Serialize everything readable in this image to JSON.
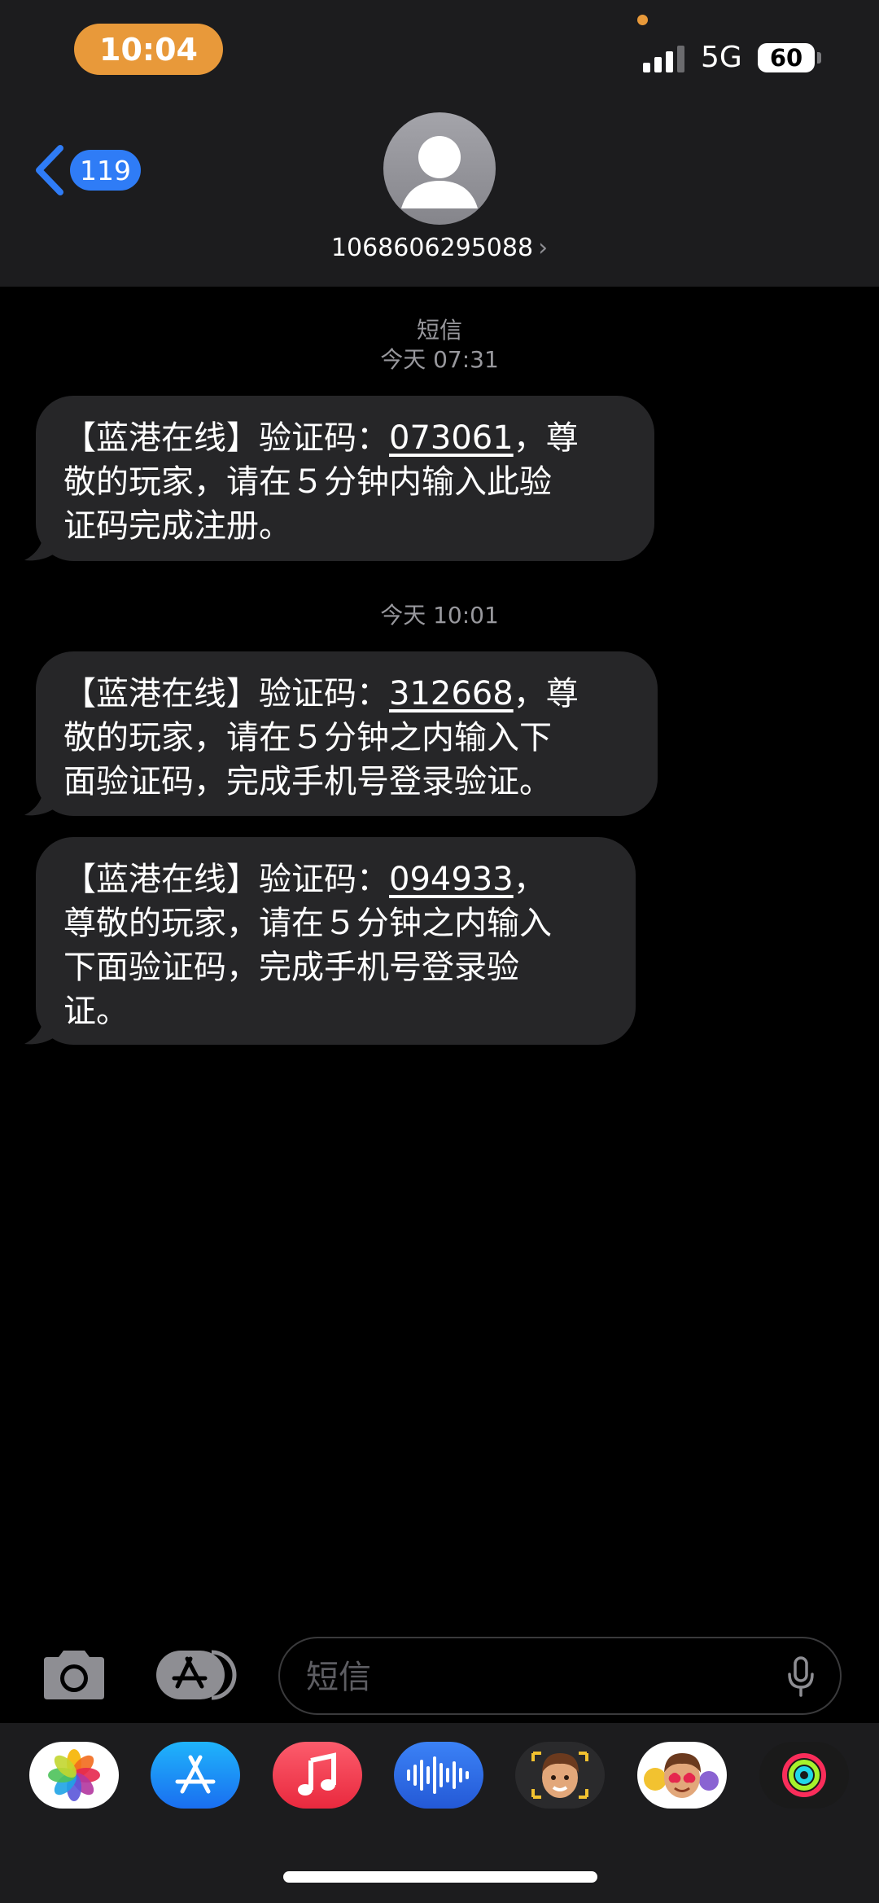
{
  "status_bar": {
    "time": "10:04",
    "network": "5G",
    "battery": "60"
  },
  "header": {
    "back_count": "119",
    "contact": "1068606295088",
    "contact_chevron": "›"
  },
  "conversation": {
    "service_label": "短信",
    "groups": [
      {
        "timestamp": "今天 07:31",
        "messages": [
          {
            "line1_pre": "【蓝港在线】验证码：",
            "code": "073061",
            "line1_post": "，尊",
            "line2": "敬的玩家，请在５分钟内输入此验",
            "line3": "证码完成注册。"
          }
        ]
      },
      {
        "timestamp": "今天 10:01",
        "messages": [
          {
            "line1_pre": "【蓝港在线】验证码：",
            "code": "312668",
            "line1_post": "，尊",
            "line2": "敬的玩家，请在５分钟之内输入下",
            "line3": "面验证码，完成手机号登录验证。"
          },
          {
            "line1_pre": "【蓝港在线】验证码：",
            "code": "094933",
            "line1_post": "，",
            "line2": "尊敬的玩家，请在５分钟之内输入",
            "line3": "下面验证码，完成手机号登录验",
            "line4": "证。"
          }
        ]
      }
    ]
  },
  "input": {
    "placeholder": "短信"
  },
  "app_drawer": [
    {
      "name": "photos-app-icon",
      "color": "#ffffff"
    },
    {
      "name": "app-store-app-icon",
      "color": "#1a8cf5"
    },
    {
      "name": "music-app-icon",
      "color": "#f4404f"
    },
    {
      "name": "audio-message-app-icon",
      "color": "#2f6fe8"
    },
    {
      "name": "memoji-app-icon",
      "color": "#2a2a2c"
    },
    {
      "name": "memoji-stickers-app-icon",
      "color": "#ffffff"
    },
    {
      "name": "activity-app-icon",
      "color": "#1a1a1a"
    }
  ],
  "colors": {
    "accent": "#2f7cf6",
    "time_pill": "#e8993a",
    "bubble": "#262628",
    "header": "#1c1c1e"
  }
}
